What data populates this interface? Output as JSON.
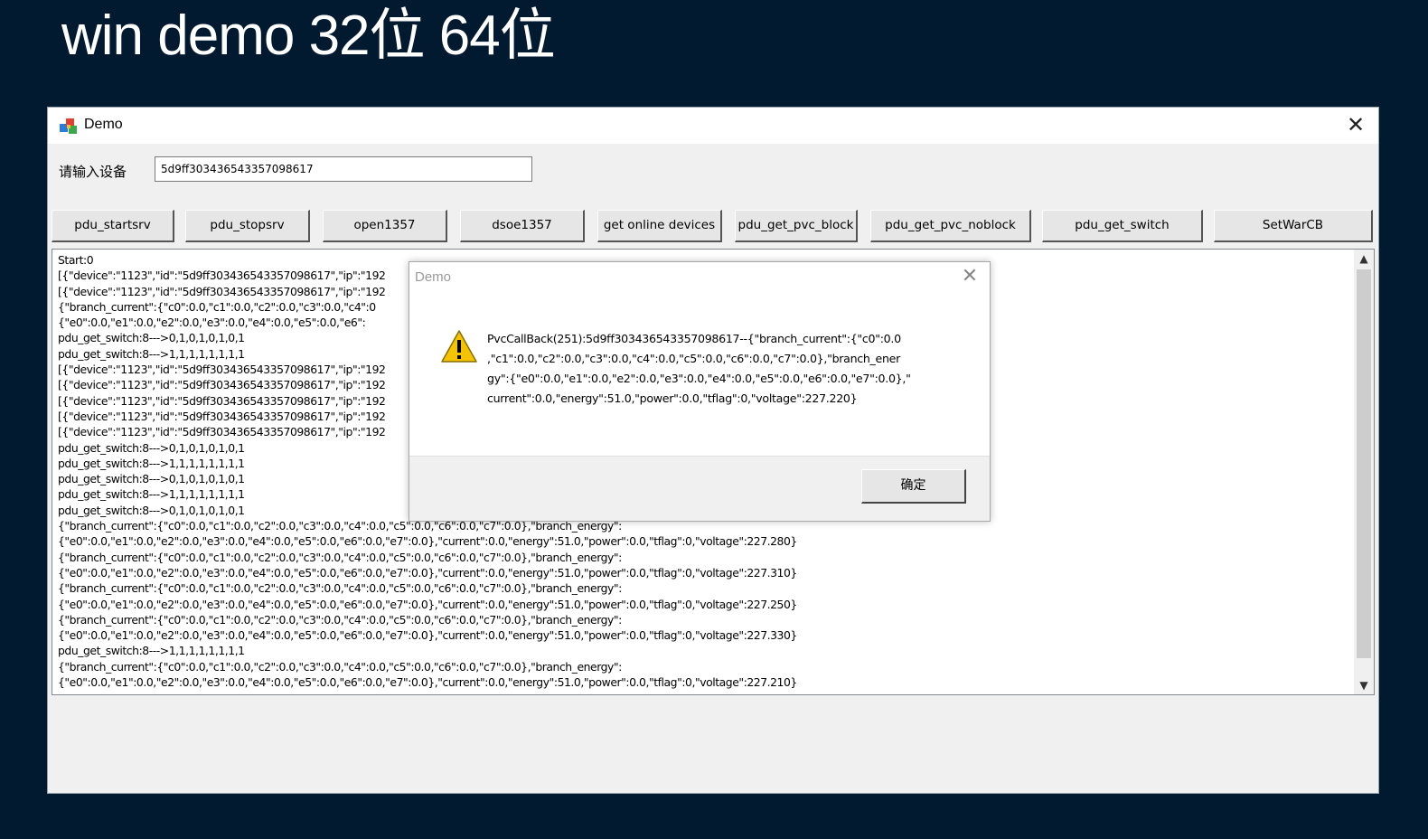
{
  "heading": "win demo 32位 64位",
  "window": {
    "title": "Demo",
    "device_label": "请输入设备",
    "device_value": "5d9ff303436543357098617"
  },
  "buttons": [
    "pdu_startsrv",
    "pdu_stopsrv",
    "open1357",
    "dsoe1357",
    "get online devices",
    "pdu_get_pvc_block",
    "pdu_get_pvc_noblock",
    "pdu_get_switch",
    "SetWarCB"
  ],
  "log_lines": [
    "Start:0",
    "[{\"device\":\"1123\",\"id\":\"5d9ff303436543357098617\",\"ip\":\"192",
    "[{\"device\":\"1123\",\"id\":\"5d9ff303436543357098617\",\"ip\":\"192",
    "{\"branch_current\":{\"c0\":0.0,\"c1\":0.0,\"c2\":0.0,\"c3\":0.0,\"c4\":0",
    "{\"e0\":0.0,\"e1\":0.0,\"e2\":0.0,\"e3\":0.0,\"e4\":0.0,\"e5\":0.0,\"e6\":",
    "pdu_get_switch:8--->0,1,0,1,0,1,0,1",
    "pdu_get_switch:8--->1,1,1,1,1,1,1,1",
    "[{\"device\":\"1123\",\"id\":\"5d9ff303436543357098617\",\"ip\":\"192",
    "[{\"device\":\"1123\",\"id\":\"5d9ff303436543357098617\",\"ip\":\"192",
    "[{\"device\":\"1123\",\"id\":\"5d9ff303436543357098617\",\"ip\":\"192",
    "[{\"device\":\"1123\",\"id\":\"5d9ff303436543357098617\",\"ip\":\"192",
    "[{\"device\":\"1123\",\"id\":\"5d9ff303436543357098617\",\"ip\":\"192",
    "pdu_get_switch:8--->0,1,0,1,0,1,0,1",
    "pdu_get_switch:8--->1,1,1,1,1,1,1,1",
    "pdu_get_switch:8--->0,1,0,1,0,1,0,1",
    "pdu_get_switch:8--->1,1,1,1,1,1,1,1",
    "pdu_get_switch:8--->0,1,0,1,0,1,0,1",
    "{\"branch_current\":{\"c0\":0.0,\"c1\":0.0,\"c2\":0.0,\"c3\":0.0,\"c4\":0.0,\"c5\":0.0,\"c6\":0.0,\"c7\":0.0},\"branch_energy\":",
    "{\"e0\":0.0,\"e1\":0.0,\"e2\":0.0,\"e3\":0.0,\"e4\":0.0,\"e5\":0.0,\"e6\":0.0,\"e7\":0.0},\"current\":0.0,\"energy\":51.0,\"power\":0.0,\"tflag\":0,\"voltage\":227.280}",
    "{\"branch_current\":{\"c0\":0.0,\"c1\":0.0,\"c2\":0.0,\"c3\":0.0,\"c4\":0.0,\"c5\":0.0,\"c6\":0.0,\"c7\":0.0},\"branch_energy\":",
    "{\"e0\":0.0,\"e1\":0.0,\"e2\":0.0,\"e3\":0.0,\"e4\":0.0,\"e5\":0.0,\"e6\":0.0,\"e7\":0.0},\"current\":0.0,\"energy\":51.0,\"power\":0.0,\"tflag\":0,\"voltage\":227.310}",
    "{\"branch_current\":{\"c0\":0.0,\"c1\":0.0,\"c2\":0.0,\"c3\":0.0,\"c4\":0.0,\"c5\":0.0,\"c6\":0.0,\"c7\":0.0},\"branch_energy\":",
    "{\"e0\":0.0,\"e1\":0.0,\"e2\":0.0,\"e3\":0.0,\"e4\":0.0,\"e5\":0.0,\"e6\":0.0,\"e7\":0.0},\"current\":0.0,\"energy\":51.0,\"power\":0.0,\"tflag\":0,\"voltage\":227.250}",
    "{\"branch_current\":{\"c0\":0.0,\"c1\":0.0,\"c2\":0.0,\"c3\":0.0,\"c4\":0.0,\"c5\":0.0,\"c6\":0.0,\"c7\":0.0},\"branch_energy\":",
    "{\"e0\":0.0,\"e1\":0.0,\"e2\":0.0,\"e3\":0.0,\"e4\":0.0,\"e5\":0.0,\"e6\":0.0,\"e7\":0.0},\"current\":0.0,\"energy\":51.0,\"power\":0.0,\"tflag\":0,\"voltage\":227.330}",
    "pdu_get_switch:8--->1,1,1,1,1,1,1,1",
    "{\"branch_current\":{\"c0\":0.0,\"c1\":0.0,\"c2\":0.0,\"c3\":0.0,\"c4\":0.0,\"c5\":0.0,\"c6\":0.0,\"c7\":0.0},\"branch_energy\":",
    "{\"e0\":0.0,\"e1\":0.0,\"e2\":0.0,\"e3\":0.0,\"e4\":0.0,\"e5\":0.0,\"e6\":0.0,\"e7\":0.0},\"current\":0.0,\"energy\":51.0,\"power\":0.0,\"tflag\":0,\"voltage\":227.210}"
  ],
  "dialog": {
    "title": "Demo",
    "message_lines": [
      "PvcCallBack(251):5d9ff303436543357098617--{\"branch_current\":{\"c0\":0.0",
      ",\"c1\":0.0,\"c2\":0.0,\"c3\":0.0,\"c4\":0.0,\"c5\":0.0,\"c6\":0.0,\"c7\":0.0},\"branch_ener",
      "gy\":{\"e0\":0.0,\"e1\":0.0,\"e2\":0.0,\"e3\":0.0,\"e4\":0.0,\"e5\":0.0,\"e6\":0.0,\"e7\":0.0},\"",
      "current\":0.0,\"energy\":51.0,\"power\":0.0,\"tflag\":0,\"voltage\":227.220}"
    ],
    "ok_label": "确定"
  },
  "icons": {
    "app": "demo-app-icon",
    "warning": "warning-icon",
    "close": "close-icon"
  },
  "colors": {
    "background": "#011a30",
    "window": "#f0f0f0",
    "warning": "#f5c400"
  }
}
